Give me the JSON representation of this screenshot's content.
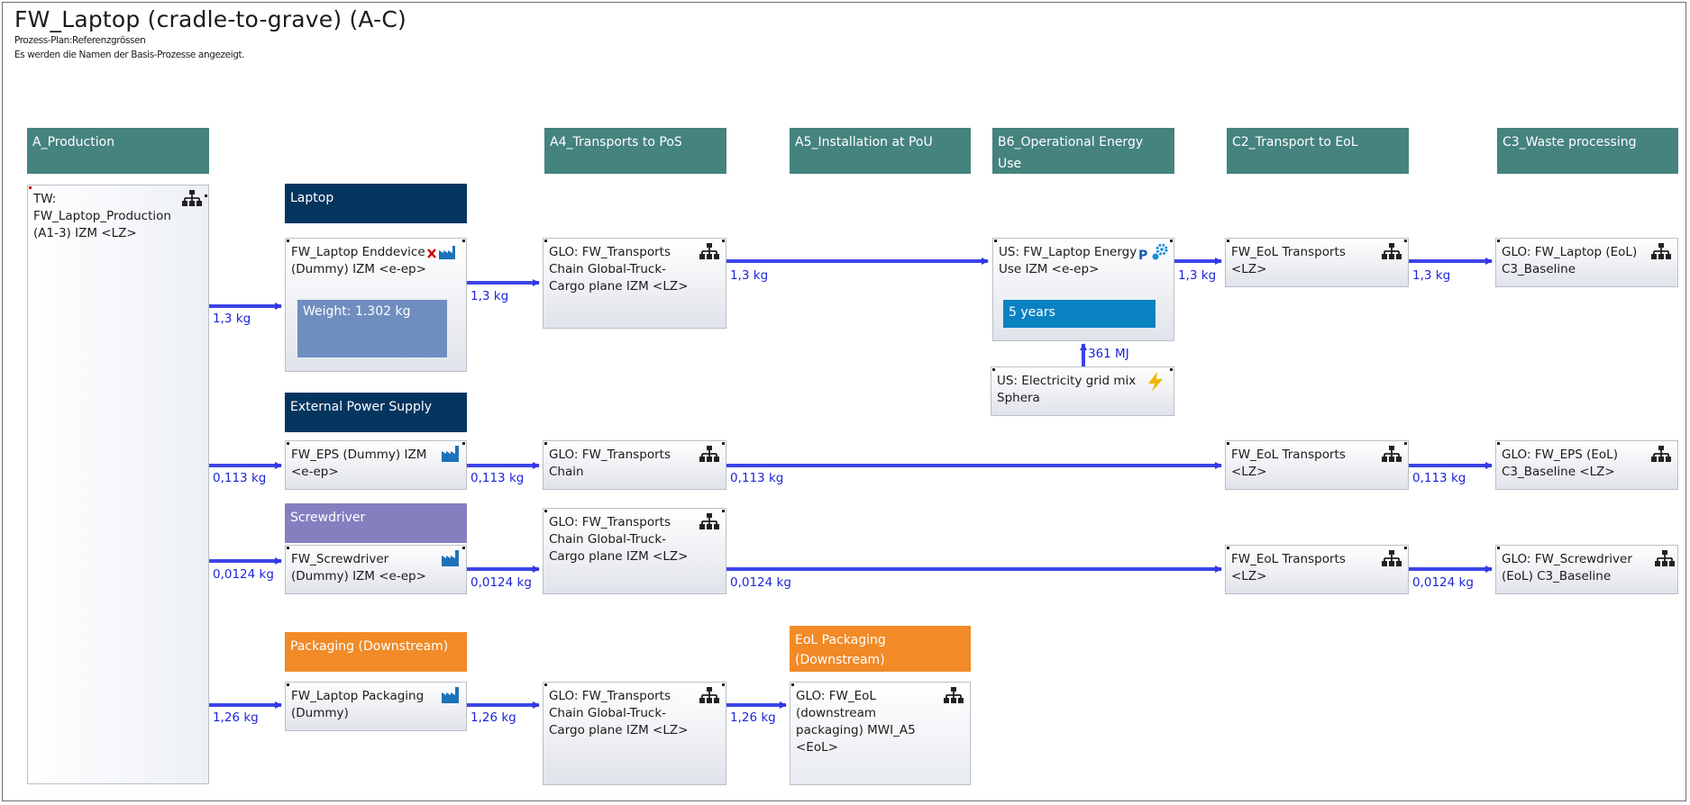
{
  "title": "FW_Laptop (cradle-to-grave) (A-C)",
  "subtitle_1": "Prozess-Plan:Referenzgrössen",
  "subtitle_2": "Es werden die Namen der Basis-Prozesse angezeigt.",
  "phases": {
    "a_production": "A_Production",
    "a4": "A4_Transports to PoS",
    "a5": "A5_Installation at PoU",
    "b6": "B6_Operational Energy Use",
    "c2": "C2_Transport to EoL",
    "c3": "C3_Waste processing"
  },
  "groups": {
    "laptop": "Laptop",
    "eps": "External Power Supply",
    "screwdriver": "Screwdriver",
    "packaging": "Packaging (Downstream)",
    "eol_packaging": "EoL Packaging (Downstream)"
  },
  "processes": {
    "tw_production": "TW: FW_Laptop_Production (A1-3) IZM <LZ>",
    "laptop_enddevice": "FW_Laptop Enddevice (Dummy) IZM <e-ep>",
    "laptop_weight": "Weight: 1.302 kg",
    "transport_laptop": "GLO: FW_Transports Chain Global-Truck-Cargo plane IZM <LZ>",
    "energy_use": "US: FW_Laptop Energy Use IZM <e-ep>",
    "energy_years": "5 years",
    "electricity": "US: Electricity grid mix Sphera",
    "eol_transport_laptop": "FW_EoL Transports <LZ>",
    "eol_laptop": "GLO: FW_Laptop (EoL) C3_Baseline",
    "eps": "FW_EPS (Dummy) IZM <e-ep>",
    "transport_eps": "GLO: FW_Transports Chain",
    "eol_transport_eps": "FW_EoL Transports <LZ>",
    "eol_eps": "GLO: FW_EPS (EoL) C3_Baseline <LZ>",
    "screwdriver": "FW_Screwdriver (Dummy) IZM <e-ep>",
    "transport_screwdriver": "GLO: FW_Transports Chain Global-Truck-Cargo plane IZM <LZ>",
    "eol_transport_screwdriver": "FW_EoL Transports <LZ>",
    "eol_screwdriver": "GLO: FW_Screwdriver (EoL) C3_Baseline",
    "packaging": "FW_Laptop Packaging (Dummy)",
    "transport_packaging": "GLO: FW_Transports Chain Global-Truck-Cargo plane IZM <LZ>",
    "eol_packaging": "GLO: FW_EoL (downstream packaging) MWI_A5 <EoL>"
  },
  "flows": {
    "laptop_in": "1,3 kg",
    "laptop_a4": "1,3 kg",
    "laptop_b6": "1,3 kg",
    "laptop_c2": "1,3 kg",
    "laptop_c3": "1,3 kg",
    "electricity": "361 MJ",
    "eps_in": "0,113 kg",
    "eps_a4": "0,113 kg",
    "eps_c2": "0,113 kg",
    "eps_c3": "0,113 kg",
    "screw_in": "0,0124 kg",
    "screw_a4": "0,0124 kg",
    "screw_c2": "0,0124 kg",
    "screw_c3": "0,0124 kg",
    "pack_in": "1,26 kg",
    "pack_a4": "1,26 kg",
    "pack_a5": "1,26 kg"
  },
  "icons": {
    "plan": "hierarchy-icon",
    "factory": "factory-icon",
    "error": "x-mark-icon",
    "energy": "lightning-icon",
    "parameter": "p-gear-icon"
  },
  "colors": {
    "phase": "#45837f",
    "group_navy": "#04355f",
    "group_violet": "#8480c0",
    "group_orange": "#f18a27",
    "flow": "#3338e6",
    "years": "#0a82c2"
  }
}
